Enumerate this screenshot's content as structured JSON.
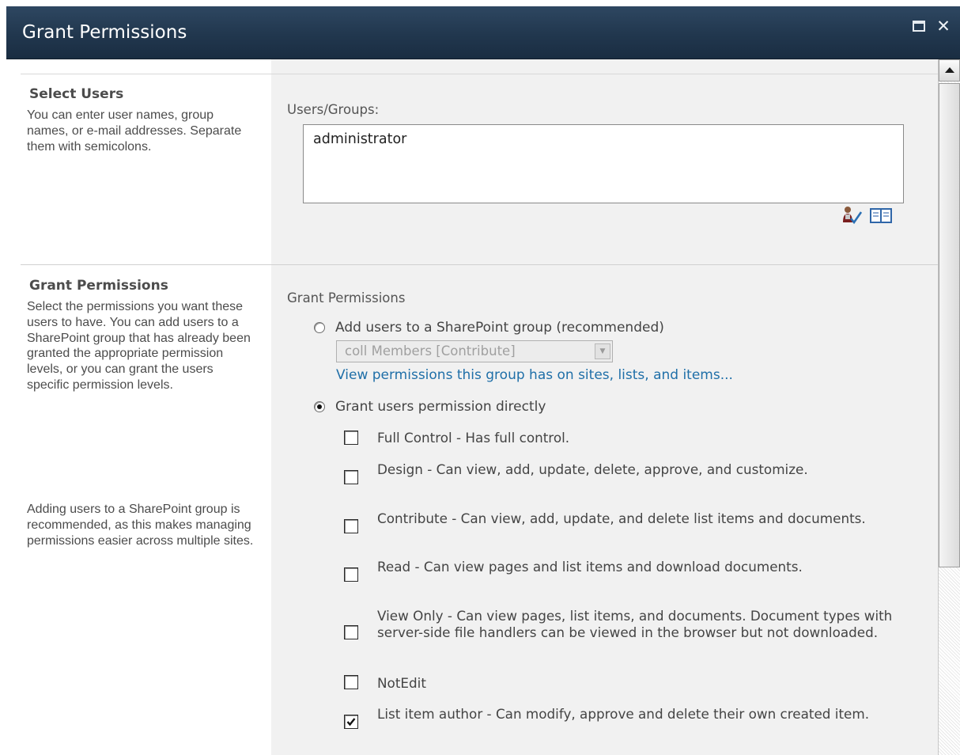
{
  "dialog": {
    "title": "Grant Permissions",
    "maximize_icon": "maximize-icon",
    "close_icon": "close-icon",
    "close_glyph": "✕"
  },
  "select_users": {
    "title": "Select Users",
    "description": "You can enter user names, group names, or e-mail addresses. Separate them with semicolons.",
    "field_label": "Users/Groups:",
    "value": "administrator",
    "check_names_icon": "check-names-icon",
    "address_book_icon": "address-book-icon"
  },
  "grant_permissions": {
    "title": "Grant Permissions",
    "description_1": "Select the permissions you want these users to have. You can add users to a SharePoint group that has already been granted the appropriate permission levels, or you can grant the users specific permission levels.",
    "description_2": "Adding users to a SharePoint group is recommended, as this makes managing permissions easier across multiple sites.",
    "group_label": "Grant Permissions",
    "option_group": {
      "label": "Add users to a SharePoint group (recommended)",
      "selected": false
    },
    "group_select": {
      "value": "coll Members [Contribute]",
      "disabled": true
    },
    "view_link": "View permissions this group has on sites, lists, and items...",
    "option_direct": {
      "label": "Grant users permission directly",
      "selected": true
    },
    "permissions": [
      {
        "label": "Full Control - Has full control.",
        "checked": false
      },
      {
        "label": "Design - Can view, add, update, delete, approve, and customize.",
        "checked": false
      },
      {
        "label": "Contribute - Can view, add, update, and delete list items and documents.",
        "checked": false
      },
      {
        "label": "Read - Can view pages and list items and download documents.",
        "checked": false
      },
      {
        "label": "View Only - Can view pages, list items, and documents. Document types with server-side file handlers can be viewed in the browser but not downloaded.",
        "checked": false
      },
      {
        "label": "NotEdit",
        "checked": false
      },
      {
        "label": "List item author - Can modify, approve and delete their own created item.",
        "checked": true
      }
    ]
  },
  "scrollbar": {
    "up_icon": "scroll-up-arrow-icon"
  }
}
